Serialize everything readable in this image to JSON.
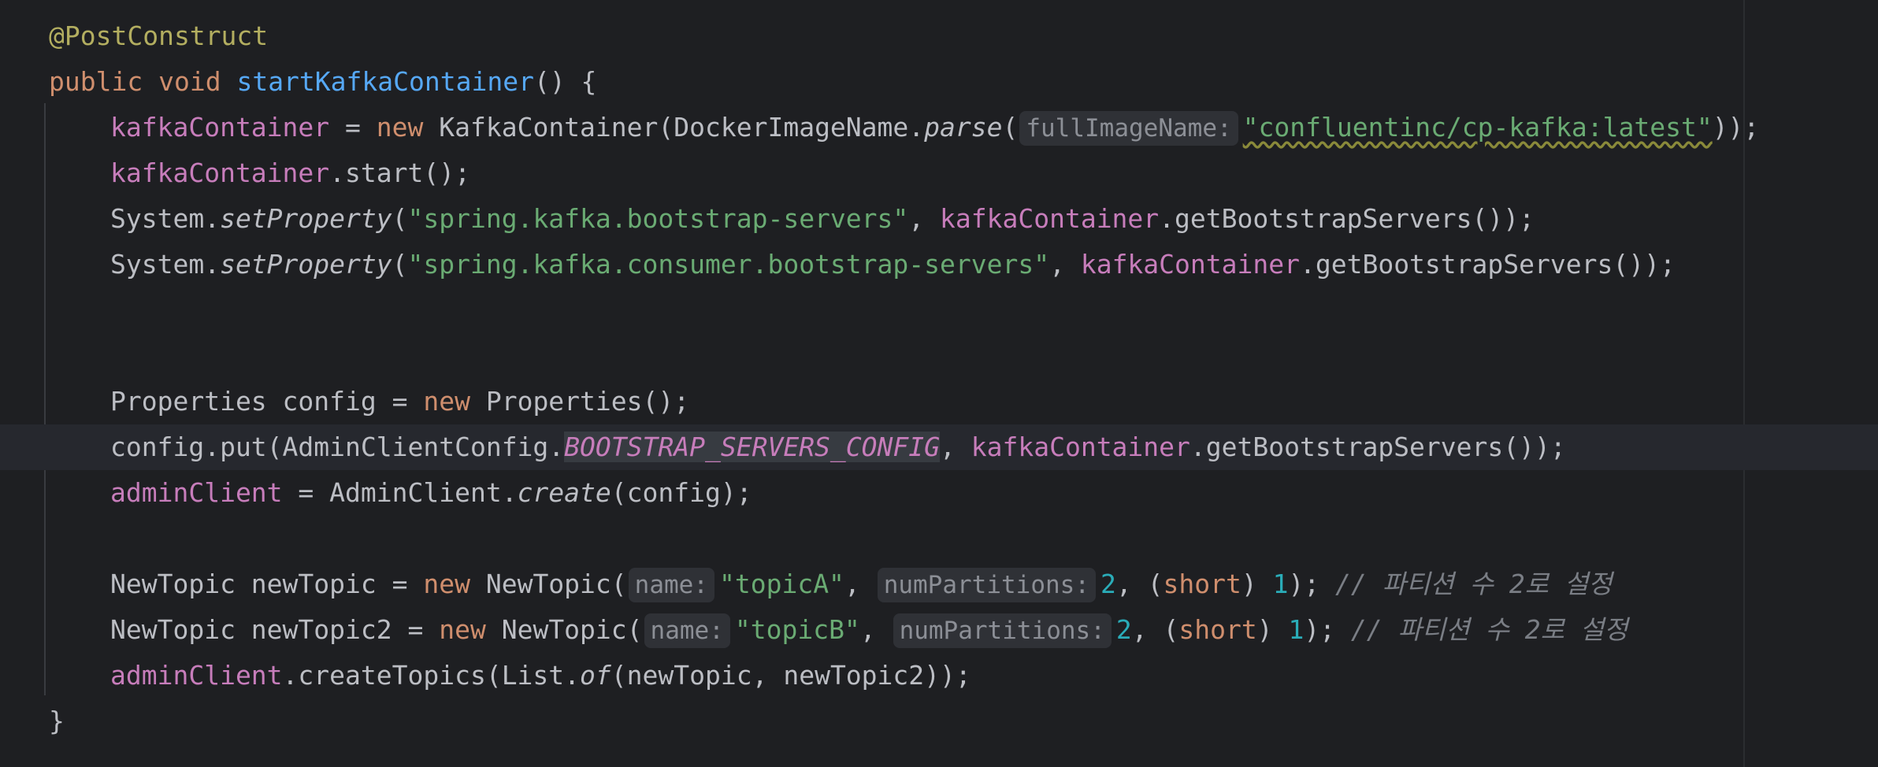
{
  "code": {
    "annotation": "@PostConstruct",
    "kw_public": "public",
    "kw_void": "void",
    "kw_new": "new",
    "kw_short": "short",
    "method_name": "startKafkaContainer",
    "paren_open_brace": "() {",
    "close_brace": "}",
    "var_kafka": "kafkaContainer",
    "var_admin": "adminClient",
    "l3_assign": " = ",
    "l3_class": " KafkaContainer(DockerImageName.",
    "l3_parse": "parse",
    "l3_open": "(",
    "hint_full_image": "fullImageName:",
    "l3_image": "\"confluentinc/cp-kafka:latest\"",
    "l3_end": "));",
    "l4_rest": ".start();",
    "system_dot": "System.",
    "set_property": "setProperty",
    "l5_str": "\"spring.kafka.bootstrap-servers\"",
    "l6_str": "\"spring.kafka.consumer.bootstrap-servers\"",
    "comma_space": ", ",
    "get_servers_end": ".getBootstrapServers());",
    "l8_start": "Properties config = ",
    "l8_end": " Properties();",
    "l9_start": "config.put(AdminClientConfig.",
    "l9_const": "BOOTSTRAP_SERVERS_CONFIG",
    "l10_mid": " = AdminClient.",
    "l10_create": "create",
    "l10_end": "(config);",
    "l12_start": "NewTopic newTopic = ",
    "l13_start": "NewTopic newTopic2 = ",
    "newtopic_open": " NewTopic(",
    "hint_name": "name:",
    "topic_a": "\"topicA\"",
    "topic_b": "\"topicB\"",
    "hint_partitions": "numPartitions:",
    "num_2": "2",
    "num_1": "1",
    "open_cast": ", (",
    "close_cast": ") ",
    "semi_space": "); ",
    "comment": "// 파티션 수 2로 설정",
    "l14_mid": ".createTopics(List.",
    "l14_of": "of",
    "l14_end": "(newTopic, newTopic2));"
  }
}
